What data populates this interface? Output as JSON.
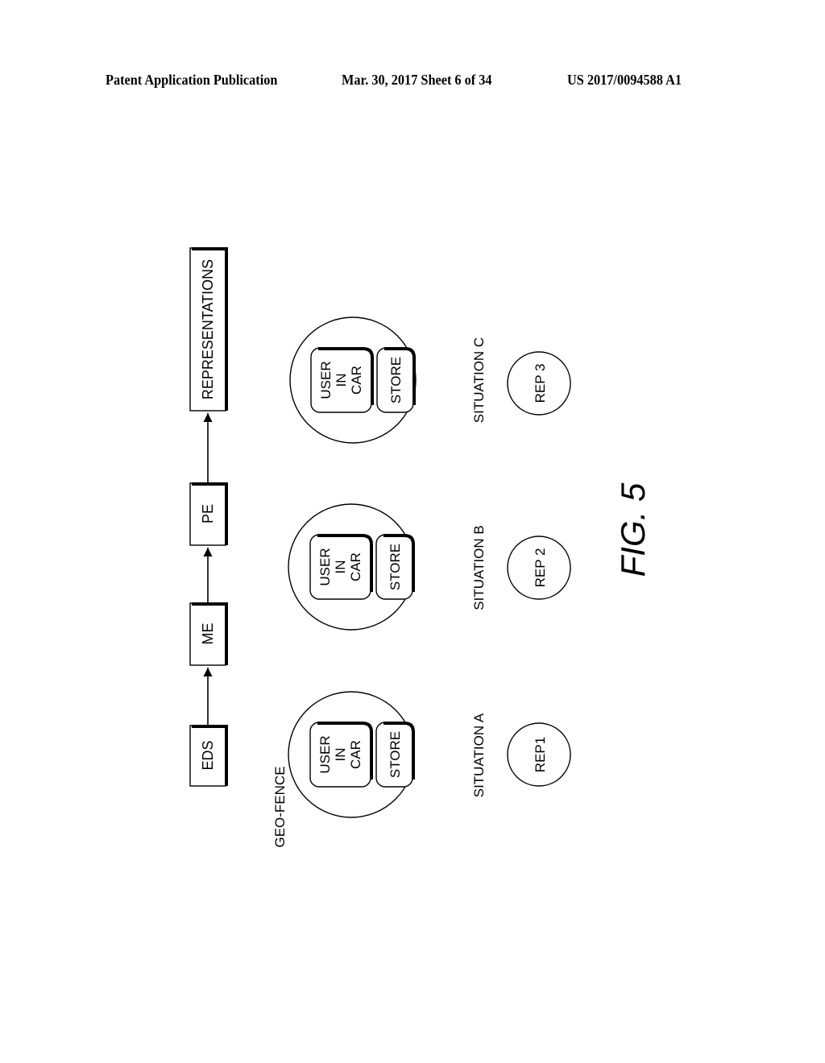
{
  "header": {
    "publication_label": "Patent Application Publication",
    "date_sheet": "Mar. 30, 2017  Sheet 6 of 34",
    "publication_number": "US 2017/0094588 A1"
  },
  "figure": {
    "caption": "FIG. 5",
    "pipeline": [
      {
        "id": "eds",
        "label": "EDS"
      },
      {
        "id": "me",
        "label": "ME"
      },
      {
        "id": "pe",
        "label": "PE"
      },
      {
        "id": "representations",
        "label": "REPRESENTATIONS"
      }
    ],
    "geofence_label": "GEO-FENCE",
    "situations": [
      {
        "label": "SITUATION A",
        "user_box": [
          "USER",
          "IN",
          "CAR"
        ],
        "store_box": "STORE",
        "representation": "REP1"
      },
      {
        "label": "SITUATION B",
        "user_box": [
          "USER",
          "IN",
          "CAR"
        ],
        "store_box": "STORE",
        "representation": "REP 2"
      },
      {
        "label": "SITUATION C",
        "user_box": [
          "USER",
          "IN",
          "CAR"
        ],
        "store_box": "STORE",
        "representation": "REP 3"
      }
    ]
  }
}
